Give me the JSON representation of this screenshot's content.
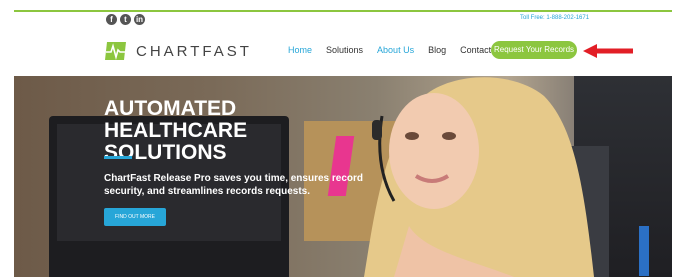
{
  "header": {
    "social": [
      "f",
      "t",
      "in"
    ],
    "toll_free": "Toll Free: 1-888-202-1671",
    "brand": "CHARTFAST",
    "nav": [
      {
        "label": "Home",
        "active": true
      },
      {
        "label": "Solutions",
        "active": false
      },
      {
        "label": "About Us",
        "active": true
      },
      {
        "label": "Blog",
        "active": false
      },
      {
        "label": "Contact",
        "active": false
      }
    ],
    "cta": "Request Your Records"
  },
  "hero": {
    "title": "AUTOMATED HEALTHCARE SOLUTIONS",
    "body": "ChartFast Release Pro saves you time, ensures record security, and streamlines records requests.",
    "button": "FIND OUT MORE"
  },
  "colors": {
    "accent_green": "#8cc63f",
    "accent_blue": "#27a6d8",
    "arrow_red": "#e21e26"
  }
}
